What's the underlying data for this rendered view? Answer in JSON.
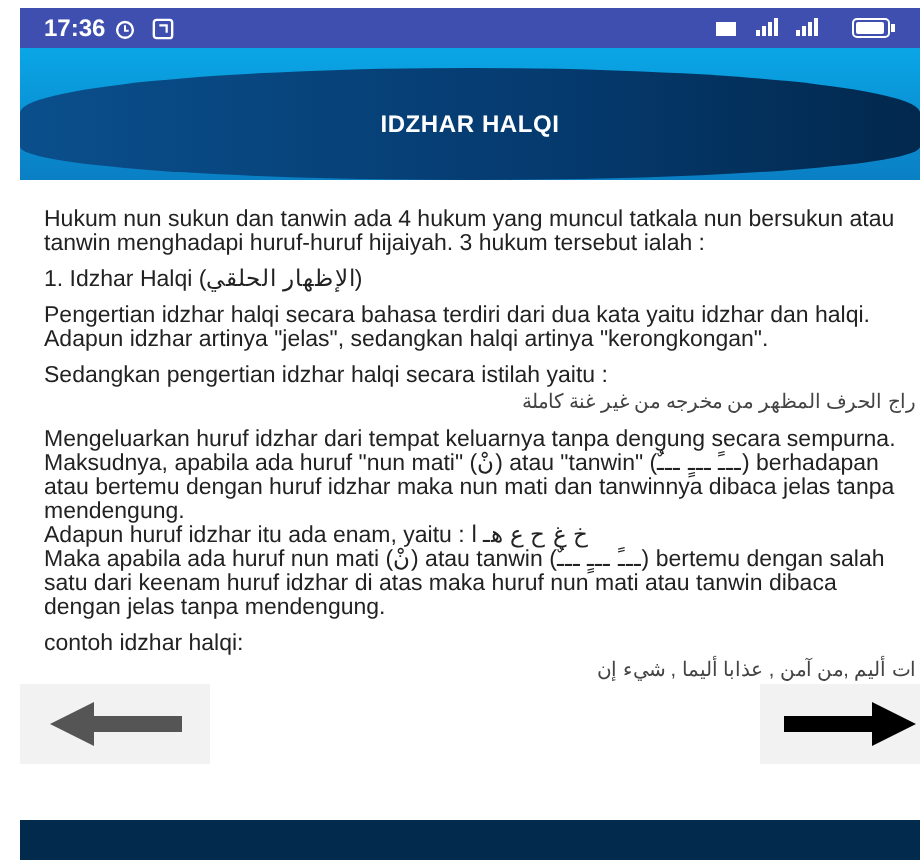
{
  "status_bar": {
    "time": "17:36"
  },
  "header": {
    "title": "IDZHAR HALQI"
  },
  "blocks": [
    {
      "lines": [
        {
          "kind": "text",
          "text": "Hukum nun sukun dan tanwin ada 4 hukum yang muncul tatkala nun bersukun atau tanwin menghadapi huruf-huruf hijaiyah. 3 hukum tersebut ialah :"
        }
      ]
    },
    {
      "lines": [
        {
          "kind": "text",
          "text": "1. Idzhar Halqi (الإظهار الحلقي)"
        }
      ]
    },
    {
      "lines": [
        {
          "kind": "text",
          "text": "Pengertian idzhar halqi secara bahasa terdiri dari dua kata yaitu idzhar dan halqi. Adapun idzhar artinya \"jelas\", sedangkan halqi artinya \"kerongkongan\"."
        }
      ]
    },
    {
      "lines": [
        {
          "kind": "text",
          "text": "Sedangkan pengertian idzhar halqi secara istilah yaitu :"
        },
        {
          "kind": "arabic",
          "text": "راج الحرف المظهر من مخرجه من غير غنة كاملة"
        }
      ]
    },
    {
      "lines": [
        {
          "kind": "text",
          "text": "Mengeluarkan huruf idzhar dari tempat keluarnya tanpa dengung secara sempurna."
        },
        {
          "kind": "text",
          "text": "Maksudnya, apabila ada huruf \"nun mati\" (نْ) atau \"tanwin\" (ـــً ـــٍ ـــٌ) berhadapan atau bertemu dengan huruf idzhar maka nun mati dan tanwinnya dibaca jelas tanpa mendengung."
        },
        {
          "kind": "text",
          "text": "Adapun huruf idzhar itu ada enam, yaitu : خ غ ح ع هـ ا"
        },
        {
          "kind": "text",
          "text": "Maka apabila ada huruf nun mati (نْ) atau tanwin (ـــً ـــٍ ـــٌ) bertemu dengan salah satu dari keenam huruf idzhar di atas maka huruf nun mati atau tanwin dibaca dengan jelas tanpa mendengung."
        }
      ]
    },
    {
      "lines": [
        {
          "kind": "text",
          "text": "contoh idzhar halqi:"
        },
        {
          "kind": "arabic",
          "text": "ات أليم ,من آمن , عذابا أليما , شيء إن"
        }
      ]
    }
  ]
}
